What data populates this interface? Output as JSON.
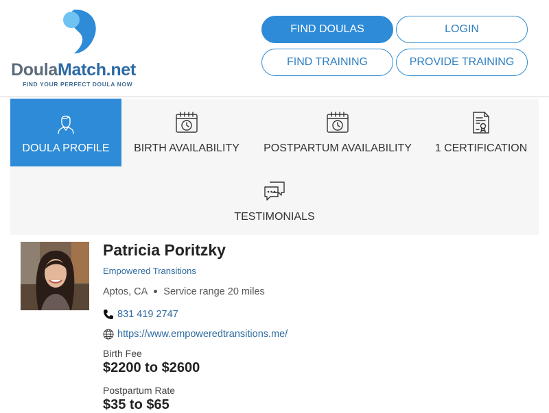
{
  "brand": {
    "name_part1": "Doula",
    "name_part2": "Match.net",
    "tagline": "FIND YOUR PERFECT DOULA NOW"
  },
  "nav": {
    "find_doulas": "FIND DOULAS",
    "login": "LOGIN",
    "find_training": "FIND TRAINING",
    "provide_training": "PROVIDE TRAINING"
  },
  "tabs": [
    {
      "label": "DOULA PROFILE",
      "icon": "person-icon",
      "active": true
    },
    {
      "label": "BIRTH AVAILABILITY",
      "icon": "calendar-clock-icon",
      "active": false
    },
    {
      "label": "POSTPARTUM AVAILABILITY",
      "icon": "calendar-clock-icon",
      "active": false
    },
    {
      "label": "1 CERTIFICATION",
      "icon": "certificate-icon",
      "active": false
    },
    {
      "label": "TESTIMONIALS",
      "icon": "chat-bubbles-icon",
      "active": false
    }
  ],
  "profile": {
    "name": "Patricia Poritzky",
    "organization": "Empowered Transitions",
    "location": "Aptos, CA",
    "service_range": "Service range 20 miles",
    "phone": "831 419 2747",
    "website": "https://www.empoweredtransitions.me/",
    "birth_fee_label": "Birth Fee",
    "birth_fee": "$2200 to $2600",
    "postpartum_label": "Postpartum Rate",
    "postpartum_rate": "$35 to $65"
  },
  "colors": {
    "accent": "#2e8bd7",
    "link": "#2e6a9f",
    "tab_bg": "#f6f6f6"
  }
}
